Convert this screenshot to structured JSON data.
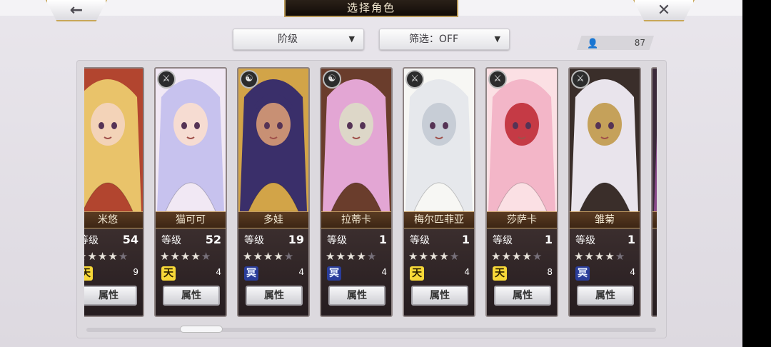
{
  "header": {
    "title": "选择角色",
    "back_icon": "←",
    "close_icon": "✕"
  },
  "filters": {
    "rank_label": "阶级",
    "filter_label": "筛选：OFF",
    "arrow": "▼"
  },
  "roster": {
    "person_icon": "👤",
    "count": "87"
  },
  "level_label": "等级",
  "attr_label": "属性",
  "star_char": "★",
  "characters": [
    {
      "name": "米悠",
      "level": "54",
      "stars": 4,
      "type": "天",
      "type_class": "tian",
      "count": "9",
      "badge": "",
      "colors": [
        "#e9c36a",
        "#b2452f",
        "#f3d3b8"
      ]
    },
    {
      "name": "猫可可",
      "level": "52",
      "stars": 4,
      "type": "天",
      "type_class": "tian",
      "count": "4",
      "badge": "⚔",
      "colors": [
        "#c7c2ee",
        "#f1e8f4",
        "#f6dcd2"
      ]
    },
    {
      "name": "多娃",
      "level": "19",
      "stars": 4,
      "type": "冥",
      "type_class": "ming",
      "count": "4",
      "badge": "☯",
      "colors": [
        "#3a2f6a",
        "#d2a448",
        "#c89074"
      ]
    },
    {
      "name": "拉蒂卡",
      "level": "1",
      "stars": 4,
      "type": "冥",
      "type_class": "ming",
      "count": "4",
      "badge": "☯",
      "colors": [
        "#e3a6d4",
        "#6a3d2c",
        "#ddd7c8"
      ]
    },
    {
      "name": "梅尔匹菲亚",
      "level": "1",
      "stars": 4,
      "type": "天",
      "type_class": "tian",
      "count": "4",
      "badge": "⚔",
      "colors": [
        "#e6e8ec",
        "#f7f7f4",
        "#c7cdd6"
      ]
    },
    {
      "name": "莎萨卡",
      "level": "1",
      "stars": 4,
      "type": "天",
      "type_class": "tian",
      "count": "8",
      "badge": "⚔",
      "colors": [
        "#f3b6c8",
        "#fbe0e4",
        "#c53a45"
      ]
    },
    {
      "name": "雏菊",
      "level": "1",
      "stars": 4,
      "type": "冥",
      "type_class": "ming",
      "count": "4",
      "badge": "⚔",
      "colors": [
        "#e9e4ec",
        "#3a2e2a",
        "#c5a15a"
      ]
    },
    {
      "name": "",
      "level": "",
      "stars": 0,
      "type": "",
      "type_class": "ming",
      "count": "",
      "badge": "",
      "colors": [
        "#8a4a8a",
        "#3b2a3a",
        "#c77aa9"
      ]
    }
  ]
}
